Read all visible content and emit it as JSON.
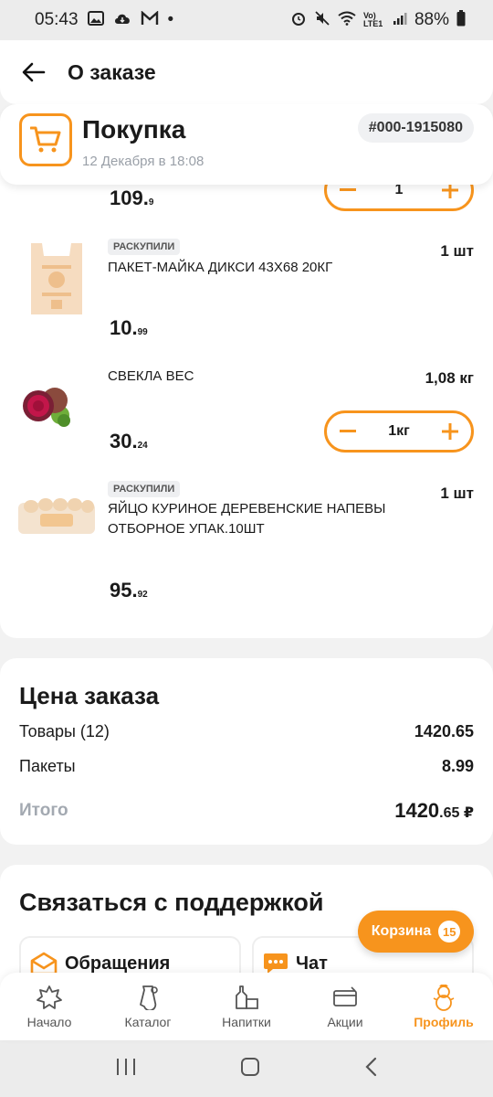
{
  "status_bar": {
    "time": "05:43",
    "dot": "•",
    "signal_text": "Vo) LTE1",
    "battery": "88%"
  },
  "header": {
    "title": "О заказе"
  },
  "order": {
    "type": "Покупка",
    "date": "12 Декабря в 18:08",
    "number": "#000-1915080"
  },
  "items": [
    {
      "price_main": "109.",
      "price_cents": "9",
      "stepper_value": "1"
    },
    {
      "badge": "РАСКУПИЛИ",
      "name": "ПАКЕТ-МАЙКА ДИКСИ 43X68 20КГ",
      "qty": "1 шт",
      "price_main": "10.",
      "price_cents": "99",
      "thumb": "bag-image"
    },
    {
      "name": "СВЕКЛА ВЕС",
      "qty": "1,08 кг",
      "price_main": "30.",
      "price_cents": "24",
      "stepper_value": "1кг",
      "thumb": "beet-image"
    },
    {
      "badge": "РАСКУПИЛИ",
      "name": "ЯЙЦО КУРИНОЕ ДЕРЕВЕНСКИЕ НАПЕВЫ ОТБОРНОЕ УПАК.10ШТ",
      "qty": "1 шт",
      "price_main": "95.",
      "price_cents": "92",
      "thumb": "eggs-image"
    }
  ],
  "summary": {
    "title": "Цена заказа",
    "goods_label": "Товары (12)",
    "goods_value": "1420.65",
    "bags_label": "Пакеты",
    "bags_value": "8.99",
    "total_label": "Итого",
    "total_main": "1420",
    "total_cents": ".65 ₽"
  },
  "support": {
    "title": "Связаться с поддержкой",
    "appeals_label": "Обращения",
    "chat_label": "Чат"
  },
  "cart": {
    "label": "Корзина",
    "count": "15"
  },
  "bottom_nav": [
    {
      "label": "Начало",
      "icon": "home-icon"
    },
    {
      "label": "Каталог",
      "icon": "catalog-icon"
    },
    {
      "label": "Напитки",
      "icon": "drinks-icon"
    },
    {
      "label": "Акции",
      "icon": "promo-icon"
    },
    {
      "label": "Профиль",
      "icon": "profile-icon",
      "active": true
    }
  ],
  "colors": {
    "accent": "#f7941d",
    "muted": "#9aa0a8"
  }
}
